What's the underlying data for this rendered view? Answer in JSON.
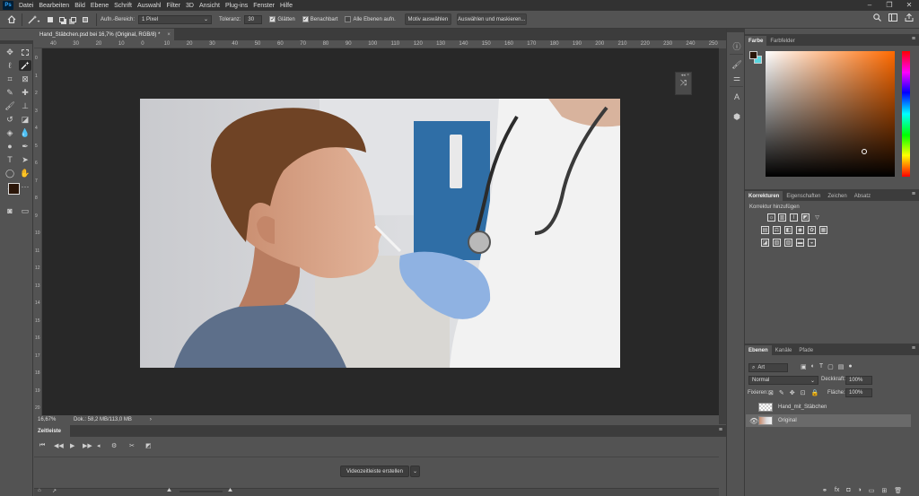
{
  "app": {
    "logo": "Ps"
  },
  "menu": [
    "Datei",
    "Bearbeiten",
    "Bild",
    "Ebene",
    "Schrift",
    "Auswahl",
    "Filter",
    "3D",
    "Ansicht",
    "Plug-ins",
    "Fenster",
    "Hilfe"
  ],
  "window_controls": [
    "–",
    "❐",
    "✕"
  ],
  "options": {
    "sample_label": "Aufn.-Bereich:",
    "sample_value": "1 Pixel",
    "tolerance_label": "Toleranz:",
    "tolerance_value": "30",
    "antialias_label": "Glätten",
    "contiguous_label": "Benachbart",
    "all_layers_label": "Alle Ebenen aufn.",
    "select_subject": "Motiv auswählen",
    "select_mask": "Auswählen und maskieren..."
  },
  "document": {
    "tab_title": "Hand_Stäbchen.psd bei 16,7% (Original, RGB/8) *",
    "zoom": "16,67%",
    "doc_info": "Dok.: 58,2 MB/113,0 MB"
  },
  "ruler_h": [
    "40",
    "30",
    "20",
    "10",
    "0",
    "10",
    "20",
    "30",
    "40",
    "50",
    "60",
    "70",
    "80",
    "90",
    "100",
    "110",
    "120",
    "130",
    "140",
    "150",
    "160",
    "170",
    "180",
    "190",
    "200",
    "210",
    "220",
    "230",
    "240",
    "250"
  ],
  "ruler_v": [
    "0",
    "1",
    "2",
    "3",
    "4",
    "5",
    "6",
    "7",
    "8",
    "9",
    "10",
    "11",
    "12",
    "13",
    "14",
    "15",
    "16",
    "17",
    "18",
    "19",
    "20"
  ],
  "timeline": {
    "tab": "Zeitleiste",
    "create_button": "Videozeitleiste erstellen"
  },
  "panels": {
    "color_tabs": [
      "Farbe",
      "Farbfelder"
    ],
    "adjust_tabs": [
      "Korrekturen",
      "Eigenschaften",
      "Zeichen",
      "Absatz"
    ],
    "adjust_hint": "Korrektur hinzufügen",
    "layers_tabs": [
      "Ebenen",
      "Kanäle",
      "Pfade"
    ],
    "filter_kind": "Art",
    "blend_mode": "Normal",
    "opacity_label": "Deckkraft:",
    "opacity_value": "100%",
    "lock_label": "Fixieren:",
    "fill_label": "Fläche:",
    "fill_value": "100%"
  },
  "layers": [
    {
      "name": "Hand_mit_Stäbchen",
      "visible": false,
      "selected": false
    },
    {
      "name": "Original",
      "visible": true,
      "selected": true
    }
  ],
  "colors": {
    "foreground": "#2a1508",
    "background": "#5ad7e0",
    "accent": "#31a8ff"
  }
}
